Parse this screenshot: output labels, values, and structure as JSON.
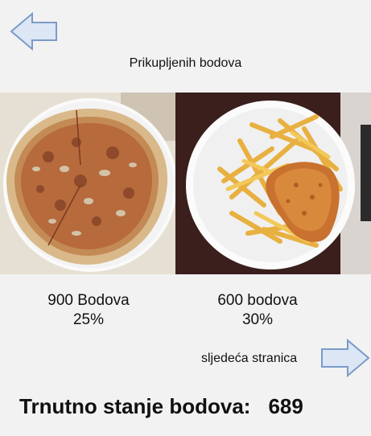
{
  "header": {
    "back_icon": "left-arrow-icon",
    "title": "Prikupljenih bodova"
  },
  "items": [
    {
      "points_label": "900 Bodova",
      "percent": "25%",
      "image": "pizza-photo"
    },
    {
      "points_label": "600 bodova",
      "percent": "30%",
      "image": "fries-schnitzel-photo"
    }
  ],
  "footer": {
    "next_label": "sljedeća stranica",
    "next_icon": "right-arrow-icon",
    "status_label": "Trnutno stanje bodova:",
    "status_value": "689"
  },
  "colors": {
    "arrow_fill": "#dce6f4",
    "arrow_stroke": "#7a9bc9",
    "background": "#f2f2f2"
  }
}
